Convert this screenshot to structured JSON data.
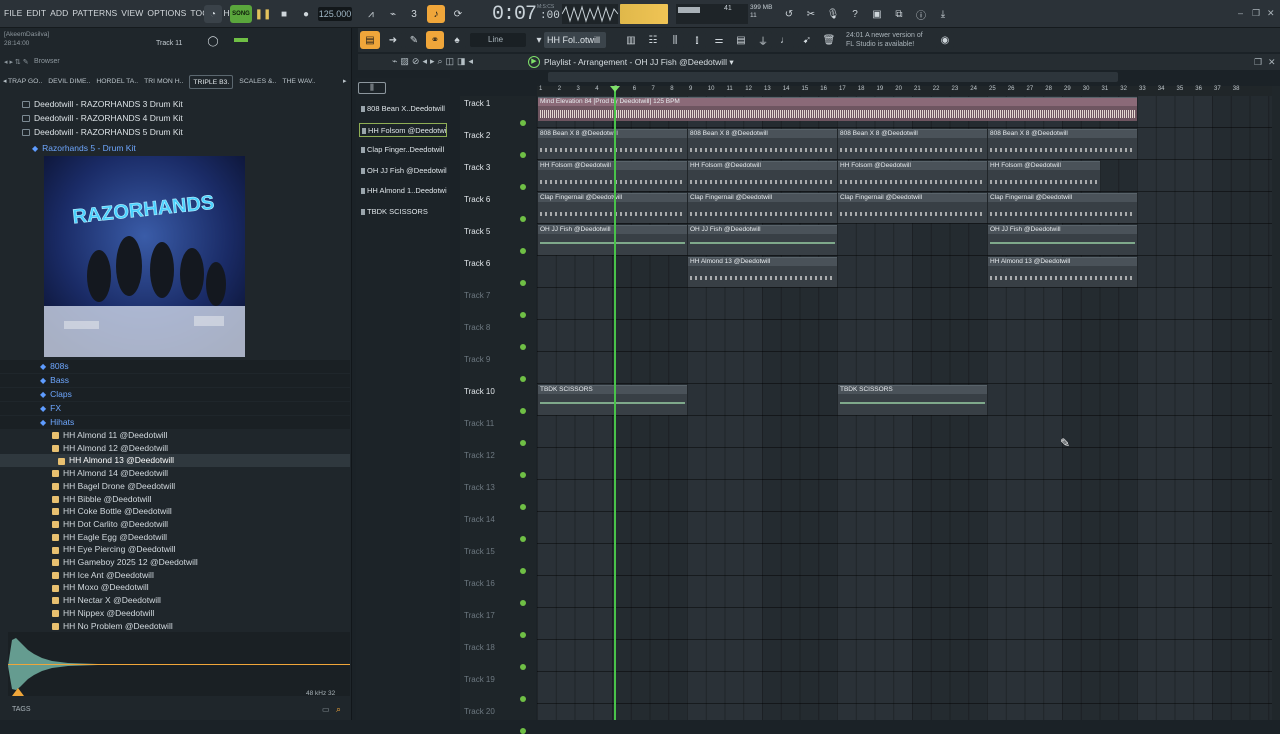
{
  "menu": [
    "FILE",
    "EDIT",
    "ADD",
    "PATTERNS",
    "VIEW",
    "OPTIONS",
    "TOOLS",
    "HELP"
  ],
  "transport": {
    "song_label": "SONG",
    "tempo": "125.000",
    "time": "0:07",
    "time_fraction": ":00",
    "time_label": "M:S:CS",
    "cpu_poly": "41",
    "memory": "399 MB",
    "memory_sub": "11",
    "polyphony": "0"
  },
  "hint_left": {
    "user": "[AkeemDasilva]",
    "time": "28:14:00",
    "track": "Track 11"
  },
  "toolbar2": {
    "snap": "Line",
    "pattern": "HH Fol..otwill",
    "update_hint_line1": "24:01  A newer version of",
    "update_hint_line2": "FL Studio is available!"
  },
  "browser": {
    "title": "Browser",
    "tabs": [
      "TRAP GO..",
      "DEVIL DIME..",
      "HORDEL TA..",
      "TRI MON H..",
      "TRIPLE B3.",
      "SCALES &..",
      "THE WAV.."
    ],
    "active_tab_index": 4,
    "folders": [
      "Deedotwill - RAZORHANDS 3 Drum Kit",
      "Deedotwill - RAZORHANDS 4 Drum Kit",
      "Deedotwill - RAZORHANDS 5 Drum Kit"
    ],
    "open_kit": "Razorhands 5 - Drum Kit",
    "subfolders": [
      "808s",
      "Bass",
      "Claps",
      "FX",
      "Hihats"
    ],
    "files": [
      "HH Almond 11 @Deedotwill",
      "HH Almond 12 @Deedotwill",
      "HH Almond 13 @Deedotwill",
      "HH Almond 14 @Deedotwill",
      "HH Bagel Drone @Deedotwill",
      "HH Bibble @Deedotwill",
      "HH Coke Bottle @Deedotwill",
      "HH Dot Carlito @Deedotwill",
      "HH Eagle Egg @Deedotwill",
      "HH Eye Piercing @Deedotwill",
      "HH Gameboy 2025 12 @Deedotwill",
      "HH Ice Ant @Deedotwill",
      "HH Moxo @Deedotwill",
      "HH Nectar X @Deedotwill",
      "HH Nippex @Deedotwill",
      "HH No Problem @Deedotwill"
    ],
    "selected_file_index": 2,
    "scope_info": "48 kHz 32",
    "tags_label": "TAGS"
  },
  "channels": [
    "808 Bean X..Deedotwill",
    "HH Folsom @Deedotwill",
    "Clap Finger..Deedotwill",
    "OH JJ Fish @Deedotwill",
    "HH Almond 1..Deedotwill",
    "TBDK SCISSORS"
  ],
  "selected_channel_index": 1,
  "playlist": {
    "title": "Playlist - Arrangement",
    "pattern": "OH JJ Fish @Deedotwill",
    "ruler": [
      "1",
      "2",
      "3",
      "4",
      "5",
      "6",
      "7",
      "8",
      "9",
      "10",
      "11",
      "12",
      "13",
      "14",
      "15",
      "16",
      "17",
      "18",
      "19",
      "20",
      "21",
      "22",
      "23",
      "24",
      "25",
      "26",
      "27",
      "28",
      "29",
      "30",
      "31",
      "32",
      "33",
      "34",
      "35",
      "36",
      "37",
      "38"
    ],
    "tracks": [
      "Track 1",
      "Track 2",
      "Track 3",
      "Track 6",
      "Track 5",
      "Track 6",
      "Track 7",
      "Track 8",
      "Track 9",
      "Track 10",
      "Track 11",
      "Track 12",
      "Track 13",
      "Track 14",
      "Track 15",
      "Track 16",
      "Track 17",
      "Track 18",
      "Track 19",
      "Track 20"
    ],
    "non_empty_tracks": [
      0,
      1,
      2,
      3,
      4,
      5,
      9
    ],
    "clips": [
      {
        "track": 0,
        "start": 1,
        "len": 32,
        "kind": "audio",
        "label": "Mind Elevation 84 [Prod by Deedotwill] 125 BPM"
      },
      {
        "track": 1,
        "start": 1,
        "len": 8,
        "kind": "pattern",
        "label": "808 Bean X 8 @Deedotwill"
      },
      {
        "track": 1,
        "start": 9,
        "len": 8,
        "kind": "pattern",
        "label": "808 Bean X 8 @Deedotwill"
      },
      {
        "track": 1,
        "start": 17,
        "len": 8,
        "kind": "pattern",
        "label": "808 Bean X 8 @Deedotwill"
      },
      {
        "track": 1,
        "start": 25,
        "len": 8,
        "kind": "pattern",
        "label": "808 Bean X 8 @Deedotwill"
      },
      {
        "track": 2,
        "start": 1,
        "len": 8,
        "kind": "pattern",
        "label": "HH Folsom @Deedotwill"
      },
      {
        "track": 2,
        "start": 9,
        "len": 8,
        "kind": "pattern",
        "label": "HH Folsom @Deedotwill"
      },
      {
        "track": 2,
        "start": 17,
        "len": 8,
        "kind": "pattern",
        "label": "HH Folsom @Deedotwill"
      },
      {
        "track": 2,
        "start": 25,
        "len": 6,
        "kind": "pattern",
        "label": "HH Folsom @Deedotwill"
      },
      {
        "track": 3,
        "start": 1,
        "len": 8,
        "kind": "pattern",
        "label": "Clap Fingernail @Deedotwill"
      },
      {
        "track": 3,
        "start": 9,
        "len": 8,
        "kind": "pattern",
        "label": "Clap Fingernail @Deedotwill"
      },
      {
        "track": 3,
        "start": 17,
        "len": 8,
        "kind": "pattern",
        "label": "Clap Fingernail @Deedotwill"
      },
      {
        "track": 3,
        "start": 25,
        "len": 8,
        "kind": "pattern",
        "label": "Clap Fingernail @Deedotwill"
      },
      {
        "track": 4,
        "start": 1,
        "len": 8,
        "kind": "pattern",
        "label": "OH JJ Fish @Deedotwill"
      },
      {
        "track": 4,
        "start": 9,
        "len": 8,
        "kind": "pattern",
        "label": "OH JJ Fish @Deedotwill"
      },
      {
        "track": 4,
        "start": 25,
        "len": 8,
        "kind": "pattern",
        "label": "OH JJ Fish @Deedotwill"
      },
      {
        "track": 5,
        "start": 9,
        "len": 8,
        "kind": "pattern",
        "label": "HH Almond 13 @Deedotwill"
      },
      {
        "track": 5,
        "start": 25,
        "len": 8,
        "kind": "pattern",
        "label": "HH Almond 13 @Deedotwill"
      },
      {
        "track": 9,
        "start": 1,
        "len": 8,
        "kind": "pattern",
        "label": "TBDK SCISSORS"
      },
      {
        "track": 9,
        "start": 17,
        "len": 8,
        "kind": "pattern",
        "label": "TBDK SCISSORS"
      }
    ]
  },
  "colors": {
    "accent_green": "#49c24a",
    "accent_orange": "#f0a63a",
    "folder_blue": "#6ea7ff",
    "audio_clip": "#6e5560"
  }
}
